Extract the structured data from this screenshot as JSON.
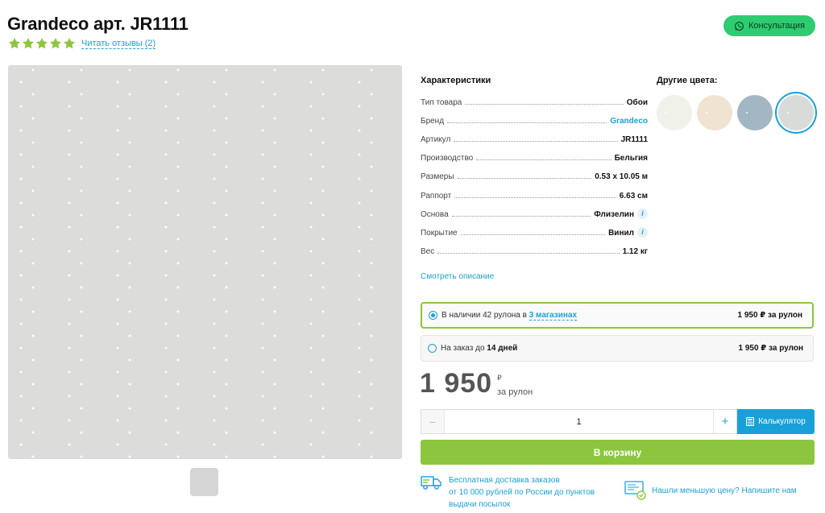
{
  "product": {
    "title": "Grandeco арт. JR1111",
    "rating": 5,
    "reviews_link": "Читать отзывы (2)"
  },
  "header": {
    "consult_label": "Консультация",
    "consult_icon": "whatsapp-icon",
    "consult_color": "#2ecc71"
  },
  "specs": {
    "title": "Характеристики",
    "rows": [
      {
        "label": "Тип товара",
        "value": "Обои"
      },
      {
        "label": "Бренд",
        "value": "Grandeco"
      },
      {
        "label": "Артикул",
        "value": "JR1111"
      },
      {
        "label": "Производство",
        "value": "Бельгия"
      },
      {
        "label": "Размеры",
        "value": "0.53 x 10.05 м"
      },
      {
        "label": "Раппорт",
        "value": "6.63 см"
      },
      {
        "label": "Основа",
        "value": "Флизелин",
        "info": "i"
      },
      {
        "label": "Покрытие",
        "value": "Винил",
        "info": "i"
      },
      {
        "label": "Вес",
        "value": "1.12 кг"
      }
    ],
    "description_link": "Смотреть описание"
  },
  "other_colors": {
    "title": "Другие цвета:",
    "swatches": [
      "#f0f2ea",
      "#f1e3d2",
      "#a3b6c3",
      "#d9dbd9"
    ]
  },
  "availability": {
    "in_stock": {
      "text": "В наличии 42 рулона в",
      "shops_link": "3 магазинах",
      "price": "1 950 ₽  за рулон"
    },
    "on_order": {
      "text": "На заказ до",
      "days": "14 дней",
      "price": "1 950 ₽  за рулон"
    }
  },
  "price": {
    "amount": "1 950",
    "currency": "₽",
    "unit": "за рулон"
  },
  "quantity": {
    "minus": "−",
    "value": "1",
    "plus": "+"
  },
  "calculator_label": "Калькулятор",
  "cart_label": "В корзину",
  "delivery": {
    "line1": "Бесплатная доставка заказов",
    "line2": "от 10 000 рублей по России до пунктов",
    "line3": "выдачи посылок"
  },
  "cheaper_text": "Нашли меньшую цену? Напишите нам",
  "colors": {
    "accent": "#1aa0d8",
    "green": "#8cc63f",
    "star": "#8cc63f",
    "image_bg": "#dcdcdb"
  }
}
